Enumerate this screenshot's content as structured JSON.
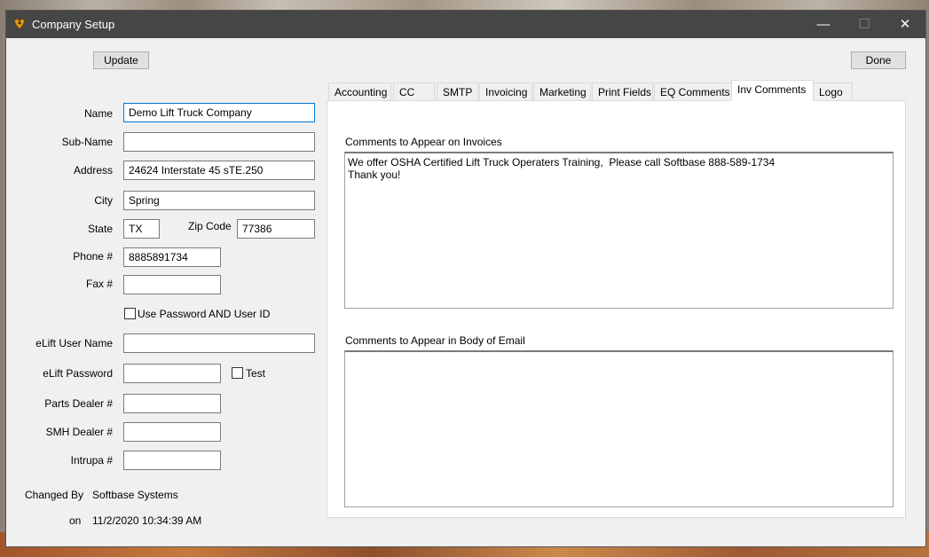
{
  "window": {
    "title": "Company Setup",
    "minimize_glyph": "—",
    "maximize_glyph": "☐",
    "close_glyph": "✕"
  },
  "toolbar": {
    "update_label": "Update",
    "done_label": "Done"
  },
  "form": {
    "name_label": "Name",
    "name_value": "Demo Lift Truck Company",
    "subname_label": "Sub-Name",
    "subname_value": "",
    "address_label": "Address",
    "address_value": "24624 Interstate 45 sTE.250",
    "city_label": "City",
    "city_value": "Spring",
    "state_label": "State",
    "state_value": "TX",
    "zip_label": "Zip Code",
    "zip_value": "77386",
    "phone_label": "Phone #",
    "phone_value": "8885891734",
    "fax_label": "Fax #",
    "fax_value": "",
    "use_password_label": "Use Password AND User ID",
    "use_password_checked": false,
    "elift_user_label": "eLift User Name",
    "elift_user_value": "",
    "elift_password_label": "eLift Password",
    "elift_password_value": "",
    "test_label": "Test",
    "test_checked": false,
    "parts_dealer_label": "Parts Dealer #",
    "parts_dealer_value": "",
    "smh_dealer_label": "SMH Dealer #",
    "smh_dealer_value": "",
    "intrupa_label": "Intrupa #",
    "intrupa_value": "",
    "changed_by_label": "Changed By",
    "changed_by_value": "Softbase Systems",
    "on_label": "on",
    "on_value": "11/2/2020 10:34:39 AM"
  },
  "tabs": [
    {
      "label": "Accounting"
    },
    {
      "label": "CC"
    },
    {
      "label": "SMTP"
    },
    {
      "label": "Invoicing"
    },
    {
      "label": "Marketing"
    },
    {
      "label": "Print Fields"
    },
    {
      "label": "EQ Comments"
    },
    {
      "label": "Inv Comments",
      "active": true
    },
    {
      "label": "Logo"
    }
  ],
  "inv_comments": {
    "invoices_label": "Comments to Appear on Invoices",
    "invoices_value": "We offer OSHA Certified Lift Truck Operaters Training,  Please call Softbase 888-589-1734\nThank you!",
    "email_label": "Comments to Appear in Body of Email",
    "email_value": ""
  }
}
